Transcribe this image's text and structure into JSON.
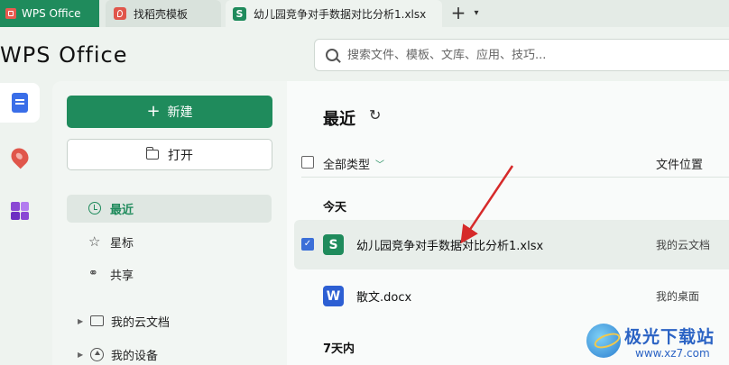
{
  "tabs": [
    {
      "label": "WPS Office",
      "active": true
    },
    {
      "label": "找稻壳模板",
      "active": false
    },
    {
      "label": "幼儿园竞争对手数据对比分析1.xlsx",
      "active": false,
      "icon_letter": "S"
    }
  ],
  "header": {
    "brand": "WPS Office",
    "search_placeholder": "搜索文件、模板、文库、应用、技巧..."
  },
  "sidebar": {
    "new_label": "新建",
    "open_label": "打开",
    "nav": [
      {
        "label": "最近",
        "icon": "clock-icon",
        "selected": true
      },
      {
        "label": "星标",
        "icon": "star-icon"
      },
      {
        "label": "共享",
        "icon": "share-icon"
      }
    ],
    "tree": [
      {
        "label": "我的云文档",
        "icon": "folder-icon"
      },
      {
        "label": "我的设备",
        "icon": "device-icon"
      }
    ]
  },
  "main": {
    "title": "最近",
    "filter_label": "全部类型",
    "location_header": "文件位置",
    "groups": {
      "today": "今天",
      "week": "7天内"
    },
    "files": [
      {
        "icon_letter": "S",
        "name": "幼儿园竞争对手数据对比分析1.xlsx",
        "location": "我的云文档",
        "checked": true
      },
      {
        "icon_letter": "W",
        "name": "散文.docx",
        "location": "我的桌面",
        "checked": false
      }
    ]
  },
  "watermark": {
    "title": "极光下载站",
    "url": "www.xz7.com"
  },
  "colors": {
    "accent_green": "#1f8b5c",
    "checkbox_blue": "#3b6fd8",
    "annotation_red": "#d62a2a"
  }
}
